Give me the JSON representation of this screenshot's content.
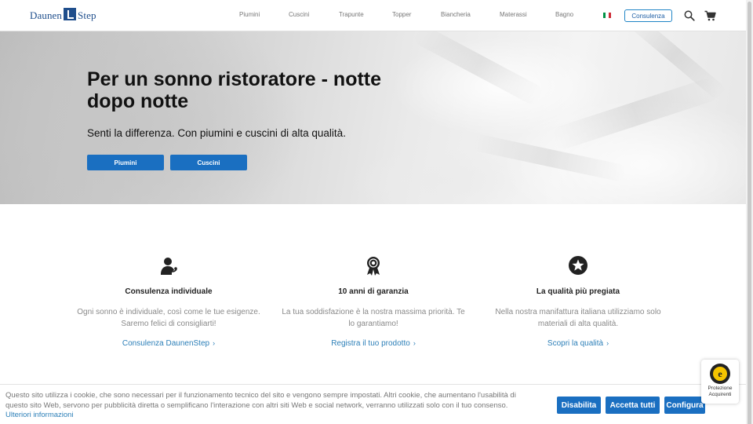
{
  "header": {
    "logo_left": "Daunen",
    "logo_right": "Step",
    "nav": [
      "Piumini",
      "Cuscini",
      "Trapunte",
      "Topper",
      "Biancheria",
      "Materassi",
      "Bagno"
    ],
    "consult_label": "Consulenza",
    "flag_colors": [
      "#009246",
      "#ffffff",
      "#ce2b37"
    ],
    "icons": [
      "search-icon",
      "cart-icon"
    ]
  },
  "hero": {
    "title": "Per un sonno ristoratore - notte dopo notte",
    "subtitle": "Senti la differenza. Con piumini e cuscini di alta qualità.",
    "buttons": [
      "Piumini",
      "Cuscini"
    ]
  },
  "features": [
    {
      "icon": "consultant-icon",
      "title": "Consulenza individuale",
      "text": "Ogni sonno è individuale, così come le tue esigenze. Saremo felici di consigliarti!",
      "link": "Consulenza DaunenStep"
    },
    {
      "icon": "award-ribbon-icon",
      "title": "10 anni di garanzia",
      "text": "La tua soddisfazione è la nostra massima priorità. Te lo garantiamo!",
      "link": "Registra il tuo prodotto"
    },
    {
      "icon": "star-circle-icon",
      "title": "La qualità più pregiata",
      "text": "Nella nostra manifattura italiana utilizziamo solo materiali di alta qualità.",
      "link": "Scopri la qualità"
    }
  ],
  "cookie": {
    "text": "Questo sito utilizza i cookie, che sono necessari per il funzionamento tecnico del sito e vengono sempre impostati. Altri cookie, che aumentano l'usabilità di questo sito Web, servono per pubblicità diretta o semplificano l'interazione con altri siti Web e social network, verranno utilizzati solo con il tuo consenso.",
    "more_link": "Ulteriori informazioni",
    "buttons": [
      "Disabilita",
      "Accetta tutti",
      "Configura"
    ]
  },
  "trust_badge": {
    "seal_letter": "e",
    "label_line1": "Protezione",
    "label_line2": "Acquirenti"
  },
  "colors": {
    "accent": "#1a6fc1",
    "link": "#2c7fb8",
    "brand": "#1f4e8c"
  }
}
